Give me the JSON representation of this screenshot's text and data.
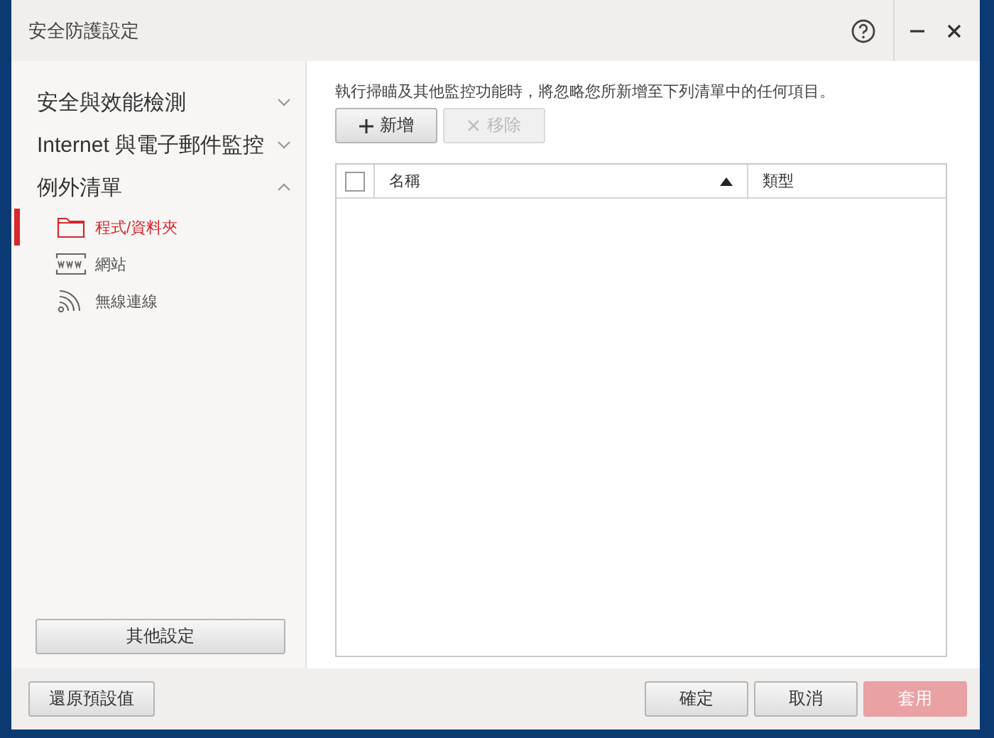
{
  "window": {
    "title": "安全防護設定"
  },
  "sidebar": {
    "sections": [
      {
        "label": "安全與效能檢測",
        "expanded": false
      },
      {
        "label": "Internet 與電子郵件監控",
        "expanded": false
      },
      {
        "label": "例外清單",
        "expanded": true,
        "children": [
          {
            "label": "程式/資料夾",
            "kind": "folder",
            "selected": true
          },
          {
            "label": "網站",
            "kind": "web",
            "selected": false
          },
          {
            "label": "無線連線",
            "kind": "wifi",
            "selected": false
          }
        ]
      }
    ],
    "other_button": "其他設定"
  },
  "main": {
    "description": "執行掃瞄及其他監控功能時，將忽略您所新增至下列清單中的任何項目。",
    "buttons": [
      {
        "label": "新增",
        "kind": "add",
        "disabled": false
      },
      {
        "label": "移除",
        "kind": "remove",
        "disabled": true
      }
    ],
    "table": {
      "select_all_checked": false,
      "columns": [
        {
          "label": "名稱",
          "sorted": true
        },
        {
          "label": "類型",
          "sorted": false
        }
      ]
    }
  },
  "footer": {
    "restore": "還原預設值",
    "buttons": [
      {
        "label": "確定",
        "primary": false,
        "disabled": false
      },
      {
        "label": "取消",
        "primary": false,
        "disabled": false
      },
      {
        "label": "套用",
        "primary": true,
        "disabled": true
      }
    ]
  }
}
